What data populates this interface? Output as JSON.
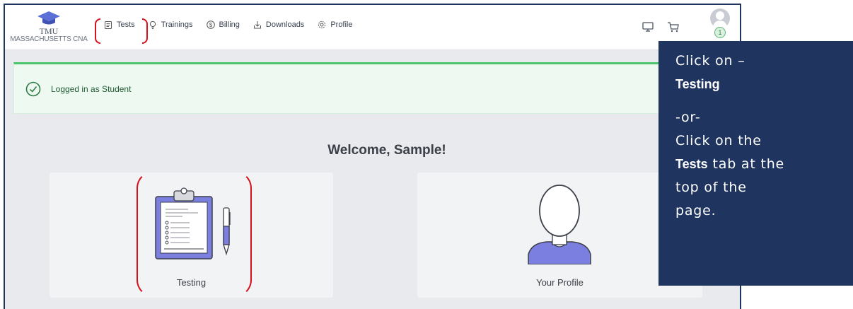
{
  "logo": {
    "abbr": "TMU",
    "full": "MASSACHUSETTS CNA"
  },
  "nav": {
    "items": [
      {
        "label": "Tests",
        "icon": "clipboard-icon"
      },
      {
        "label": "Trainings",
        "icon": "lightbulb-icon"
      },
      {
        "label": "Billing",
        "icon": "dollar-icon"
      },
      {
        "label": "Downloads",
        "icon": "download-icon"
      },
      {
        "label": "Profile",
        "icon": "gear-icon"
      }
    ]
  },
  "header_icons": [
    "monitor-icon",
    "cart-icon"
  ],
  "user": {
    "badge_count": "1"
  },
  "alert": {
    "text": "Logged in as Student",
    "color": "#4cc46d"
  },
  "welcome": "Welcome, Sample!",
  "cards": [
    {
      "label": "Testing",
      "icon": "clipboard-pen-icon"
    },
    {
      "label": "Your Profile",
      "icon": "person-icon"
    }
  ],
  "callout": {
    "line1": "Click on –",
    "line2": "Testing",
    "line3": "-or-",
    "line4": "Click on the",
    "line5_bold": "Tests",
    "line5_rest": " tab at the",
    "line6": "top of the",
    "line7": "page.",
    "bg_color": "#1f3560"
  },
  "colors": {
    "highlight": "#d4111c",
    "accent": "#7a7fe0"
  }
}
